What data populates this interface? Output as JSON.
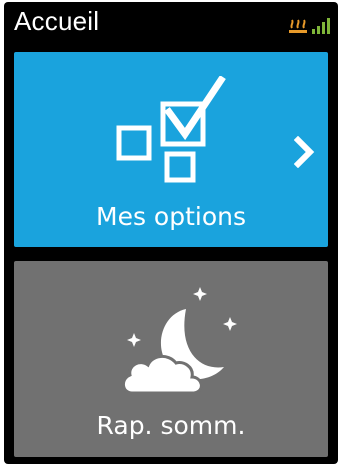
{
  "screen": {
    "title": "Accueil",
    "status_icons": [
      "heating-icon",
      "signal-icon"
    ]
  },
  "tiles": [
    {
      "label": "Mes options",
      "icon": "options-checkbox-icon",
      "color": "#1aa3dd",
      "has_arrow": true
    },
    {
      "label": "Rap. somm.",
      "icon": "moon-cloud-icon",
      "color": "#717171"
    }
  ],
  "colors": {
    "heating": "#e89a2a",
    "signal": "#7fb539",
    "background": "#000000"
  }
}
